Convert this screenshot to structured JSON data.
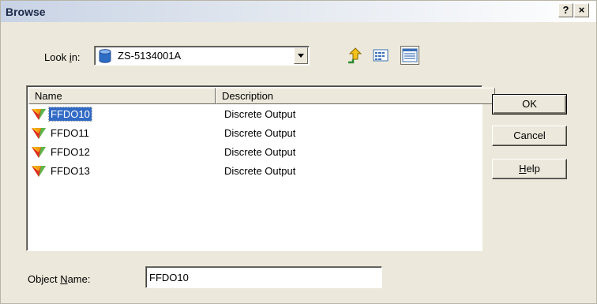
{
  "window": {
    "title": "Browse",
    "help_glyph": "?",
    "close_glyph": "×"
  },
  "lookin": {
    "label_prefix": "Look ",
    "label_hotkey": "i",
    "label_suffix": "n:",
    "value": "ZS-5134001A",
    "icon": "database-icon"
  },
  "toolbar": {
    "up_icon": "up-folder-icon",
    "list_icon": "list-view-icon",
    "details_icon": "details-view-icon"
  },
  "list": {
    "columns": [
      "Name",
      "Description"
    ],
    "rows": [
      {
        "name": "FFDO10",
        "description": "Discrete Output",
        "selected": true
      },
      {
        "name": "FFDO11",
        "description": "Discrete Output",
        "selected": false
      },
      {
        "name": "FFDO12",
        "description": "Discrete Output",
        "selected": false
      },
      {
        "name": "FFDO13",
        "description": "Discrete Output",
        "selected": false
      }
    ]
  },
  "buttons": {
    "ok": "OK",
    "cancel": "Cancel",
    "help_hotkey": "H",
    "help_rest": "elp"
  },
  "object_name": {
    "label_prefix": "Object ",
    "label_hotkey": "N",
    "label_suffix": "ame:",
    "value": "FFDO10"
  },
  "colors": {
    "selection": "#316ac5",
    "dialog_bg": "#ece9dc"
  }
}
